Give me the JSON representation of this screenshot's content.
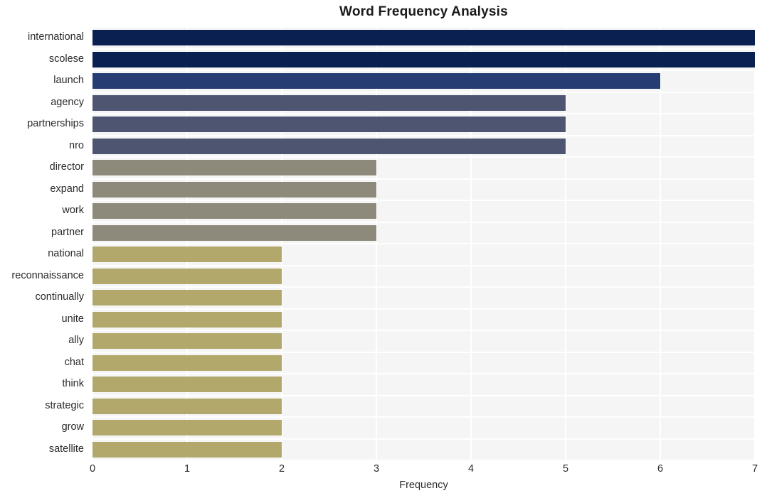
{
  "chart_data": {
    "type": "bar",
    "orientation": "horizontal",
    "title": "Word Frequency Analysis",
    "xlabel": "Frequency",
    "ylabel": "",
    "categories": [
      "international",
      "scolese",
      "launch",
      "agency",
      "partnerships",
      "nro",
      "director",
      "expand",
      "work",
      "partner",
      "national",
      "reconnaissance",
      "continually",
      "unite",
      "ally",
      "chat",
      "think",
      "strategic",
      "grow",
      "satellite"
    ],
    "values": [
      7,
      7,
      6,
      5,
      5,
      5,
      3,
      3,
      3,
      3,
      2,
      2,
      2,
      2,
      2,
      2,
      2,
      2,
      2,
      2
    ],
    "bar_colors": [
      "#0a2050",
      "#0a2050",
      "#253d73",
      "#4d5571",
      "#4d5571",
      "#4d5571",
      "#8e8a7b",
      "#8e8a7b",
      "#8e8a7b",
      "#8e8a7b",
      "#b3a86c",
      "#b3a86c",
      "#b3a86c",
      "#b3a86c",
      "#b3a86c",
      "#b3a86c",
      "#b3a86c",
      "#b3a86c",
      "#b3a86c",
      "#b3a86c"
    ],
    "xlim": [
      0,
      7
    ],
    "xticks": [
      0,
      1,
      2,
      3,
      4,
      5,
      6,
      7
    ],
    "xtick_labels": [
      "0",
      "1",
      "2",
      "3",
      "4",
      "5",
      "6",
      "7"
    ],
    "grid": true,
    "grid_color": "#ffffff",
    "plot_background": "#f5f5f6",
    "figure_background": "#ffffff",
    "legend": null,
    "text_color": "#2b2b2b",
    "title_color": "#1a1a1a"
  }
}
